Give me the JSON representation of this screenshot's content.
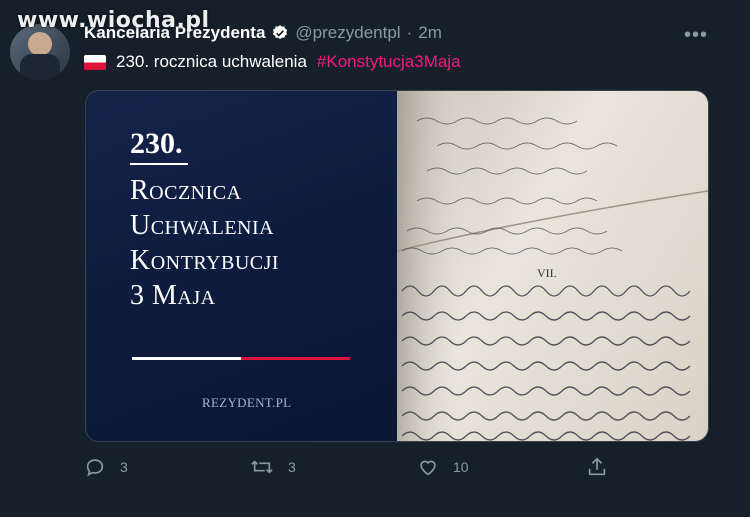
{
  "watermark": "www.wiocha.pl",
  "tweet": {
    "author_name": "Kancelaria Prezydenta",
    "handle": "@prezydentpl",
    "separator": "·",
    "time": "2m",
    "text_main": "230. rocznica uchwalenia",
    "hashtag": "#Konstytucja3Maja",
    "flag_icon": "poland-flag-icon"
  },
  "poster": {
    "number": "230.",
    "title_lines": [
      "Rocznica",
      "Uchwalenia",
      "Kontrybucji",
      "3 Maja"
    ],
    "site": "REZYDENT.PL"
  },
  "actions": {
    "reply_count": "3",
    "retweet_count": "3",
    "like_count": "10"
  },
  "colors": {
    "background": "#15202b",
    "hashtag": "#f91880",
    "verified": "#ffffff",
    "muted": "#8b98a5"
  }
}
